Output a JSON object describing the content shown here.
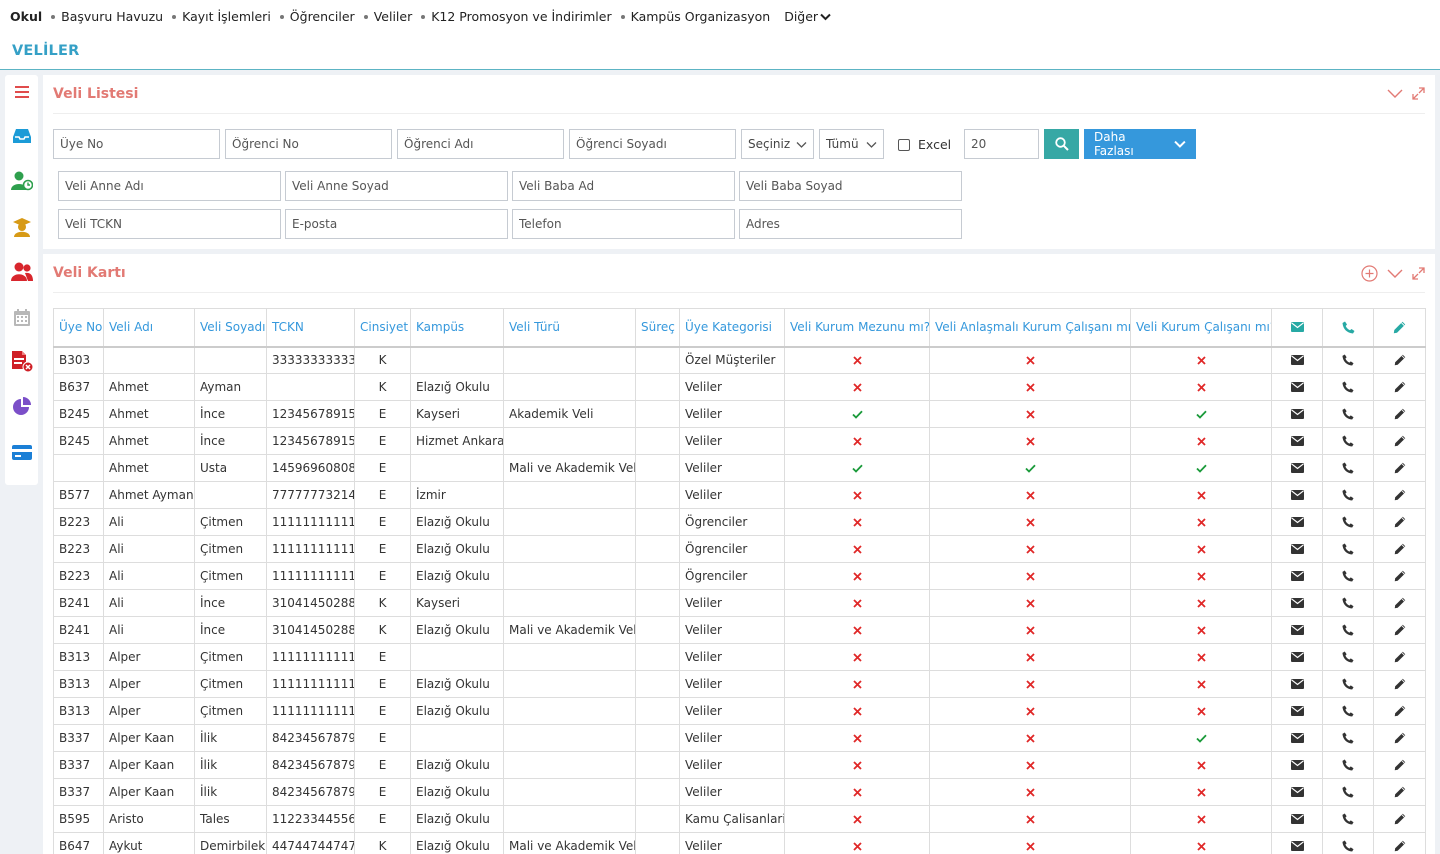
{
  "topnav": {
    "brand": "Okul",
    "items": [
      "Başvuru Havuzu",
      "Kayıt İşlemleri",
      "Öğrenciler",
      "Veliler",
      "K12 Promosyon ve İndirimler",
      "Kampüs Organizasyon"
    ],
    "more": "Diğer"
  },
  "page": {
    "title": "VELİLER"
  },
  "sidebar": [
    "menu-icon",
    "inbox-icon",
    "user-clock-icon",
    "graduate-icon",
    "users-icon",
    "calendar-icon",
    "pdf-delete-icon",
    "pie-chart-icon",
    "card-icon"
  ],
  "filter": {
    "title": "Veli Listesi",
    "uye_no": "Üye No",
    "ogrenci_no": "Öğrenci No",
    "ogrenci_adi": "Öğrenci Adı",
    "ogrenci_soyadi": "Öğrenci Soyadı",
    "select1": "Seçiniz",
    "select2": "Tümü",
    "excel": "Excel",
    "page_size": "20",
    "more_button": "Daha Fazlası",
    "veli_anne_adi": "Veli Anne Adı",
    "veli_anne_soyad": "Veli Anne Soyad",
    "veli_baba_ad": "Veli Baba Ad",
    "veli_baba_soyad": "Veli Baba Soyad",
    "veli_tckn": "Veli TCKN",
    "eposta": "E-posta",
    "telefon": "Telefon",
    "adres": "Adres"
  },
  "card": {
    "title": "Veli Kartı",
    "columns": [
      "Üye No",
      "Veli Adı",
      "Veli Soyadı",
      "TCKN",
      "Cinsiyet",
      "Kampüs",
      "Veli Türü",
      "Süreç",
      "Üye Kategorisi",
      "Veli Kurum Mezunu mı?",
      "Veli Anlaşmalı Kurum Çalışanı mı?",
      "Veli Kurum Çalışanı mı?"
    ],
    "rows": [
      {
        "no": "B303",
        "ad": "",
        "soyad": "",
        "tckn": "33333333333",
        "cins": "K",
        "kampus": "",
        "tur": "",
        "surec": "",
        "kat": "Özel Müşteriler",
        "m": false,
        "a": false,
        "c": false
      },
      {
        "no": "B637",
        "ad": "Ahmet",
        "soyad": "Ayman",
        "tckn": "",
        "cins": "K",
        "kampus": "Elazığ Okulu",
        "tur": "",
        "surec": "",
        "kat": "Veliler",
        "m": false,
        "a": false,
        "c": false
      },
      {
        "no": "B245",
        "ad": "Ahmet",
        "soyad": "İnce",
        "tckn": "12345678915",
        "cins": "E",
        "kampus": "Kayseri",
        "tur": "Akademik Veli",
        "surec": "",
        "kat": "Veliler",
        "m": true,
        "a": false,
        "c": true
      },
      {
        "no": "B245",
        "ad": "Ahmet",
        "soyad": "İnce",
        "tckn": "12345678915",
        "cins": "E",
        "kampus": "Hizmet Ankara",
        "tur": "",
        "surec": "",
        "kat": "Veliler",
        "m": false,
        "a": false,
        "c": false
      },
      {
        "no": "",
        "ad": "Ahmet",
        "soyad": "Usta",
        "tckn": "14596960808",
        "cins": "E",
        "kampus": "",
        "tur": "Mali ve Akademik Veli",
        "surec": "",
        "kat": "Veliler",
        "m": true,
        "a": true,
        "c": true
      },
      {
        "no": "B577",
        "ad": "Ahmet Ayman",
        "soyad": "",
        "tckn": "77777773214",
        "cins": "E",
        "kampus": "İzmir",
        "tur": "",
        "surec": "",
        "kat": "Veliler",
        "m": false,
        "a": false,
        "c": false
      },
      {
        "no": "B223",
        "ad": "Ali",
        "soyad": "Çitmen",
        "tckn": "11111111111",
        "cins": "E",
        "kampus": "Elazığ Okulu",
        "tur": "",
        "surec": "",
        "kat": "Ögrenciler",
        "m": false,
        "a": false,
        "c": false
      },
      {
        "no": "B223",
        "ad": "Ali",
        "soyad": "Çitmen",
        "tckn": "11111111111",
        "cins": "E",
        "kampus": "Elazığ Okulu",
        "tur": "",
        "surec": "",
        "kat": "Ögrenciler",
        "m": false,
        "a": false,
        "c": false
      },
      {
        "no": "B223",
        "ad": "Ali",
        "soyad": "Çitmen",
        "tckn": "11111111111",
        "cins": "E",
        "kampus": "Elazığ Okulu",
        "tur": "",
        "surec": "",
        "kat": "Ögrenciler",
        "m": false,
        "a": false,
        "c": false
      },
      {
        "no": "B241",
        "ad": "Ali",
        "soyad": "İnce",
        "tckn": "31041450288",
        "cins": "K",
        "kampus": "Kayseri",
        "tur": "",
        "surec": "",
        "kat": "Veliler",
        "m": false,
        "a": false,
        "c": false
      },
      {
        "no": "B241",
        "ad": "Ali",
        "soyad": "İnce",
        "tckn": "31041450288",
        "cins": "K",
        "kampus": "Elazığ Okulu",
        "tur": "Mali ve Akademik Veli",
        "surec": "",
        "kat": "Veliler",
        "m": false,
        "a": false,
        "c": false
      },
      {
        "no": "B313",
        "ad": "Alper",
        "soyad": "Çitmen",
        "tckn": "11111111111",
        "cins": "E",
        "kampus": "",
        "tur": "",
        "surec": "",
        "kat": "Veliler",
        "m": false,
        "a": false,
        "c": false
      },
      {
        "no": "B313",
        "ad": "Alper",
        "soyad": "Çitmen",
        "tckn": "11111111111",
        "cins": "E",
        "kampus": "Elazığ Okulu",
        "tur": "",
        "surec": "",
        "kat": "Veliler",
        "m": false,
        "a": false,
        "c": false
      },
      {
        "no": "B313",
        "ad": "Alper",
        "soyad": "Çitmen",
        "tckn": "11111111111",
        "cins": "E",
        "kampus": "Elazığ Okulu",
        "tur": "",
        "surec": "",
        "kat": "Veliler",
        "m": false,
        "a": false,
        "c": false
      },
      {
        "no": "B337",
        "ad": "Alper Kaan",
        "soyad": "İlik",
        "tckn": "84234567879",
        "cins": "E",
        "kampus": "",
        "tur": "",
        "surec": "",
        "kat": "Veliler",
        "m": false,
        "a": false,
        "c": true
      },
      {
        "no": "B337",
        "ad": "Alper Kaan",
        "soyad": "İlik",
        "tckn": "84234567879",
        "cins": "E",
        "kampus": "Elazığ Okulu",
        "tur": "",
        "surec": "",
        "kat": "Veliler",
        "m": false,
        "a": false,
        "c": false
      },
      {
        "no": "B337",
        "ad": "Alper Kaan",
        "soyad": "İlik",
        "tckn": "84234567879",
        "cins": "E",
        "kampus": "Elazığ Okulu",
        "tur": "",
        "surec": "",
        "kat": "Veliler",
        "m": false,
        "a": false,
        "c": false
      },
      {
        "no": "B595",
        "ad": "Aristo",
        "soyad": "Tales",
        "tckn": "11223344556",
        "cins": "E",
        "kampus": "Elazığ Okulu",
        "tur": "",
        "surec": "",
        "kat": "Kamu Çalisanlari",
        "m": false,
        "a": false,
        "c": false
      },
      {
        "no": "B647",
        "ad": "Aykut",
        "soyad": "Demirbilek",
        "tckn": "44744744747",
        "cins": "K",
        "kampus": "Elazığ Okulu",
        "tur": "Mali ve Akademik Veli",
        "surec": "",
        "kat": "Veliler",
        "m": false,
        "a": false,
        "c": false
      }
    ]
  },
  "colors": {
    "accent": "#3598dc",
    "title": "#e27a74",
    "check": "#1a9a3a",
    "cross": "#e02828",
    "page_title": "#35a0c6"
  }
}
